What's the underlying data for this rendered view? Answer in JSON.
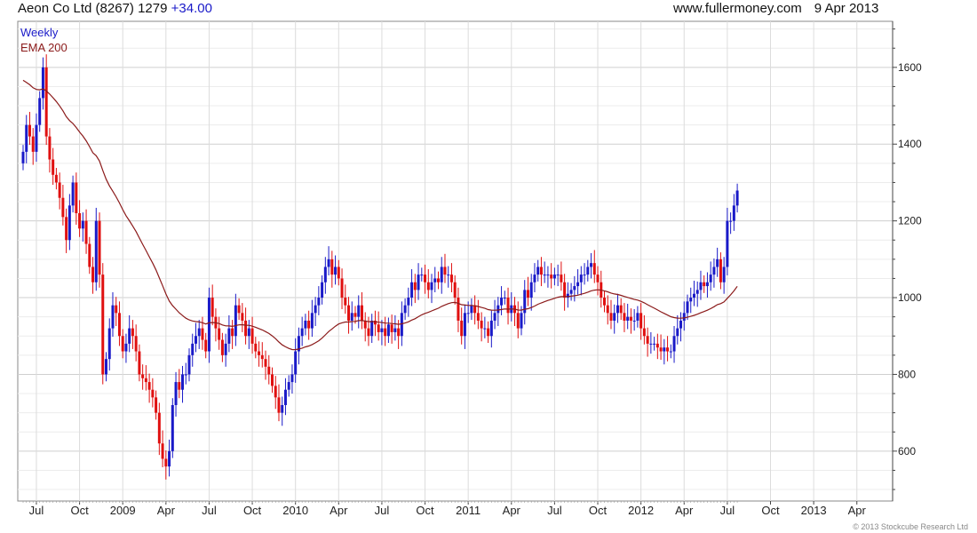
{
  "header": {
    "title": "Aeon Co Ltd (8267) 1279",
    "change": "+34.00",
    "site": "www.fullermoney.com",
    "date": "9 Apr 2013"
  },
  "copyright": "© 2013 Stockcube Research Ltd",
  "colors": {
    "up": "#1a1ac8",
    "down": "#e01010",
    "ema": "#8b1a1a",
    "grid": "#dcdcdc",
    "axis": "#444444"
  },
  "chart_data": {
    "type": "candlestick",
    "frequency": "Weekly",
    "legend": [
      {
        "label": "Weekly",
        "color": "#1a1ac8"
      },
      {
        "label": "EMA 200",
        "color": "#8b1a1a"
      }
    ],
    "legend_position": "top-left",
    "ylim": [
      470,
      1720
    ],
    "yticks": [
      600,
      800,
      1000,
      1200,
      1400,
      1600
    ],
    "y_axis_side": "right",
    "grid": true,
    "xticks": [
      "Jul",
      "Oct",
      "2009",
      "Apr",
      "Jul",
      "Oct",
      "2010",
      "Apr",
      "Jul",
      "Oct",
      "2011",
      "Apr",
      "Jul",
      "Oct",
      "2012",
      "Apr",
      "Jul",
      "Oct",
      "2013",
      "Apr"
    ],
    "xtick_week_index": [
      4,
      17,
      30,
      43,
      56,
      69,
      82,
      95,
      108,
      121,
      134,
      147,
      160,
      173,
      186,
      199,
      212,
      225,
      238,
      251
    ],
    "close": [
      1380,
      1450,
      1420,
      1380,
      1450,
      1520,
      1600,
      1420,
      1360,
      1320,
      1300,
      1260,
      1210,
      1150,
      1240,
      1300,
      1220,
      1180,
      1200,
      1140,
      1080,
      1040,
      1200,
      1060,
      800,
      840,
      920,
      980,
      960,
      900,
      860,
      880,
      920,
      900,
      860,
      800,
      790,
      780,
      760,
      740,
      700,
      620,
      580,
      560,
      600,
      720,
      780,
      760,
      800,
      800,
      850,
      880,
      900,
      920,
      890,
      860,
      1000,
      950,
      920,
      890,
      850,
      880,
      920,
      900,
      980,
      960,
      940,
      900,
      920,
      880,
      860,
      850,
      840,
      820,
      800,
      770,
      740,
      700,
      720,
      760,
      780,
      800,
      860,
      900,
      920,
      940,
      920,
      960,
      980,
      1000,
      1040,
      1080,
      1100,
      1060,
      1080,
      1050,
      1000,
      980,
      940,
      960,
      950,
      980,
      940,
      920,
      900,
      940,
      930,
      910,
      920,
      900,
      930,
      910,
      920,
      900,
      960,
      980,
      1000,
      1040,
      1020,
      1060,
      1060,
      1040,
      1020,
      1040,
      1050,
      1040,
      1080,
      1060,
      1060,
      1040,
      1000,
      940,
      900,
      960,
      960,
      980,
      960,
      940,
      920,
      920,
      900,
      940,
      960,
      980,
      1000,
      1000,
      960,
      980,
      960,
      920,
      960,
      1020,
      1000,
      1040,
      1060,
      1080,
      1060,
      1060,
      1060,
      1050,
      1060,
      1060,
      1040,
      1000,
      1010,
      1020,
      1030,
      1040,
      1060,
      1060,
      1080,
      1090,
      1060,
      1040,
      1000,
      980,
      960,
      940,
      960,
      980,
      960,
      940,
      950,
      940,
      940,
      960,
      920,
      900,
      880,
      880,
      880,
      870,
      860,
      870,
      860,
      860,
      900,
      920,
      940,
      960,
      990,
      1000,
      1010,
      1020,
      1040,
      1030,
      1040,
      1060,
      1080,
      1100,
      1040,
      1080,
      1200,
      1200,
      1240,
      1279
    ]
  }
}
